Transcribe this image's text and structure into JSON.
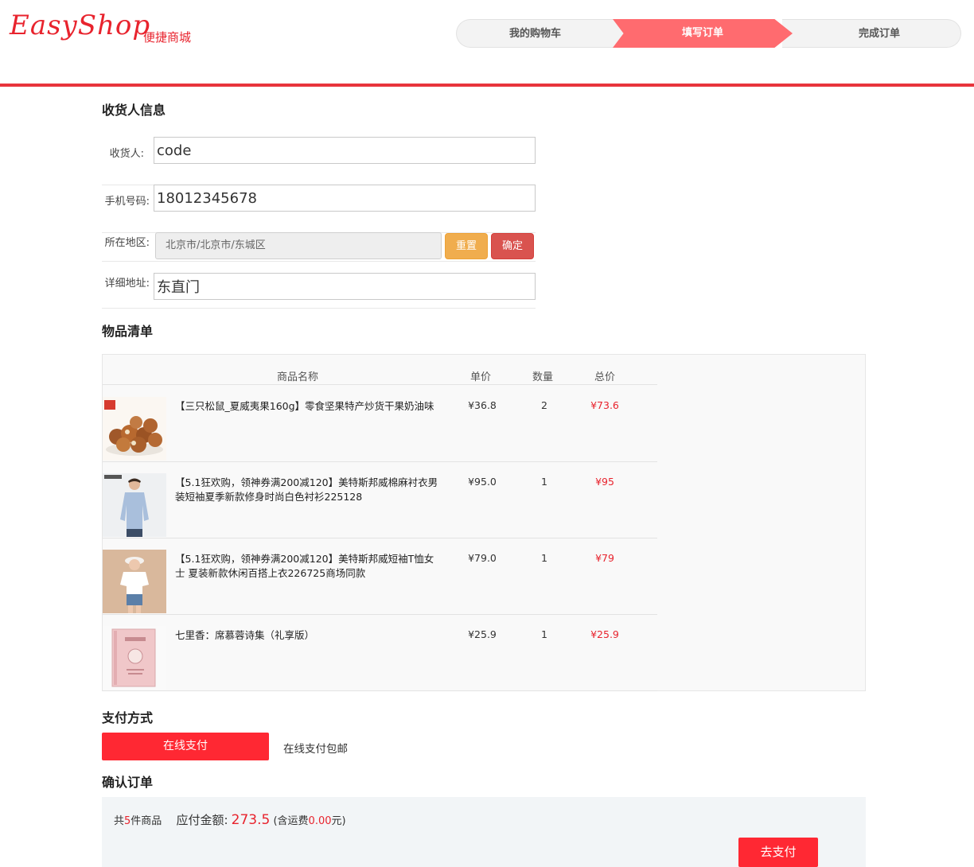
{
  "header": {
    "logo_text": "EasyShop",
    "logo_sub": "便捷商城",
    "steps": [
      "我的购物车",
      "填写订单",
      "完成订单"
    ]
  },
  "receiver": {
    "section_title": "收货人信息",
    "name_label": "收货人:",
    "name_value": "code",
    "phone_label": "手机号码:",
    "phone_value": "18012345678",
    "region_label": "所在地区:",
    "region_value": "北京市/北京市/东城区",
    "reset_label": "重置",
    "confirm_label": "确定",
    "address_label": "详细地址:",
    "address_value": "东直门"
  },
  "items": {
    "section_title": "物品清单",
    "headers": [
      "商品名称",
      "单价",
      "数量",
      "总价"
    ],
    "rows": [
      {
        "name": "【三只松鼠_夏威夷果160g】零食坚果特产炒货干果奶油味",
        "price": "¥36.8",
        "qty": "2",
        "total": "¥73.6",
        "thumb": "macadamia-nuts"
      },
      {
        "name": "【5.1狂欢购，领神券满200减120】美特斯邦威棉麻衬衣男装短袖夏季新款修身时尚白色衬衫225128",
        "price": "¥95.0",
        "qty": "1",
        "total": "¥95",
        "thumb": "mens-shirt"
      },
      {
        "name": "【5.1狂欢购，领神券满200减120】美特斯邦威短袖T恤女士 夏装新款休闲百搭上衣226725商场同款",
        "price": "¥79.0",
        "qty": "1",
        "total": "¥79",
        "thumb": "womens-tshirt"
      },
      {
        "name": "七里香：席慕蓉诗集（礼享版）",
        "price": "¥25.9",
        "qty": "1",
        "total": "¥25.9",
        "thumb": "poetry-book"
      }
    ]
  },
  "payment": {
    "section_title": "支付方式",
    "method_label": "在线支付",
    "note": "在线支付包邮"
  },
  "confirm": {
    "section_title": "确认订单",
    "count_prefix": "共",
    "count": "5",
    "count_suffix": "件商品",
    "amount_label": "应付金额:",
    "amount": "273.5",
    "shipping_prefix": "(含运费",
    "shipping": "0.00",
    "shipping_suffix": "元)",
    "pay_button": "去支付"
  },
  "colors": {
    "brand_red": "#e8232d",
    "active_step": "#ff6b6f",
    "reset_btn": "#f0ad4e",
    "ok_btn": "#d9534f"
  }
}
